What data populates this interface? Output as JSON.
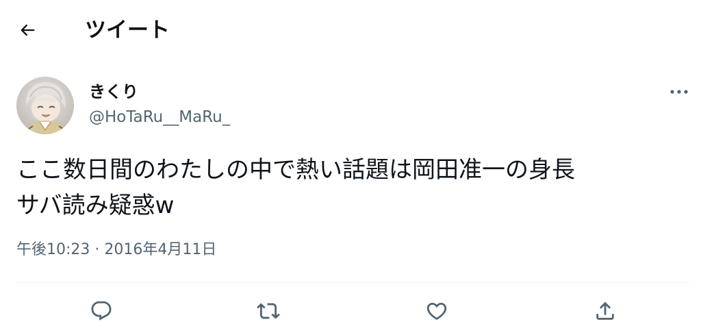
{
  "header": {
    "back_icon": "arrow-left-icon",
    "title": "ツイート"
  },
  "tweet": {
    "author": {
      "display_name": "きくり",
      "handle": "@HoTaRu__MaRu_"
    },
    "text_line1": "ここ数日間のわたしの中で熱い話題は岡田准一の身長",
    "text_line2": "サバ読み疑惑w",
    "time": "午後10:23",
    "separator": "·",
    "date": "2016年4月11日"
  },
  "actions": {
    "reply_icon": "reply-icon",
    "retweet_icon": "retweet-icon",
    "like_icon": "heart-icon",
    "share_icon": "share-icon"
  },
  "colors": {
    "text_primary": "#0f1419",
    "text_secondary": "#536471",
    "divider": "#eff3f4"
  }
}
